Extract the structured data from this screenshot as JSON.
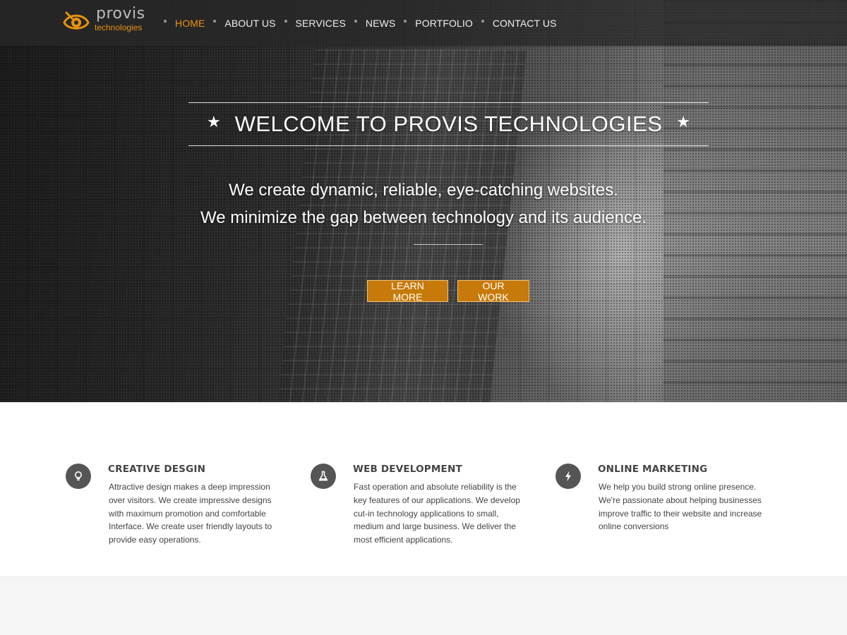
{
  "brand": {
    "name": "provis",
    "sub": "technologies",
    "accent_color": "#e8920f"
  },
  "nav": {
    "items": [
      {
        "label": "HOME",
        "active": true
      },
      {
        "label": "ABOUT US",
        "active": false
      },
      {
        "label": "SERVICES",
        "active": false
      },
      {
        "label": "NEWS",
        "active": false
      },
      {
        "label": "PORTFOLIO",
        "active": false
      },
      {
        "label": "CONTACT US",
        "active": false
      }
    ]
  },
  "hero": {
    "headline": "WELCOME TO PROVIS TECHNOLOGIES",
    "star_glyph": "★",
    "tagline_1": "We create dynamic, reliable, eye-catching websites.",
    "tagline_2": "We minimize the gap between technology and its audience.",
    "button_learn": "LEARN MORE",
    "button_work": "OUR WORK",
    "button_color": "#c77a0a"
  },
  "features": [
    {
      "icon": "lightbulb-icon",
      "title": "CREATIVE DESGIN",
      "text": "Attractive design makes a deep impression over visitors. We create impressive designs with maximum promotion and comfortable Interface. We create user friendly layouts to provide easy operations."
    },
    {
      "icon": "flask-icon",
      "title": "WEB DEVELOPMENT",
      "text": "Fast operation and absolute reliability is the key features of our applications. We develop cut-in technology applications to small, medium and large business. We deliver the most efficient applications."
    },
    {
      "icon": "lightning-icon",
      "title": "ONLINE MARKETING",
      "text": "We help you build strong online presence. We're passionate about helping businesses improve traffic to their website and increase online conversions"
    }
  ]
}
